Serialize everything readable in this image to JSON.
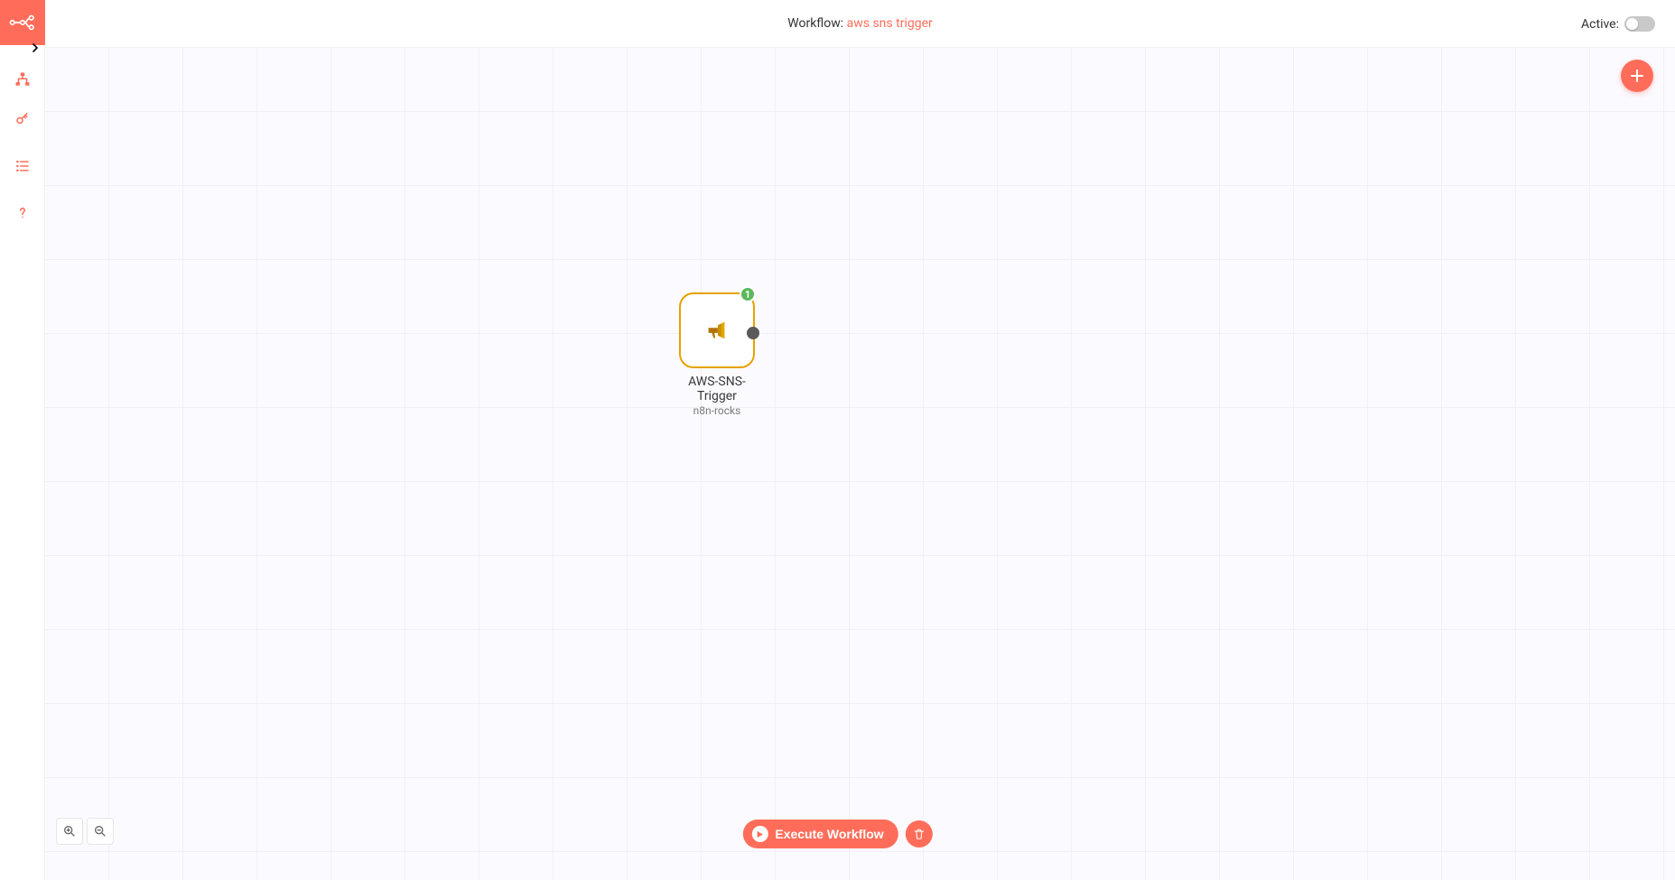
{
  "header": {
    "workflow_label": "Workflow: ",
    "workflow_name": "aws sns trigger",
    "active_label": "Active: "
  },
  "sidebar": {
    "logo_name": "n8n-logo",
    "items": [
      {
        "name": "workflows-icon"
      },
      {
        "name": "credentials-icon"
      },
      {
        "name": "executions-icon"
      },
      {
        "name": "help-icon"
      }
    ]
  },
  "fab": {
    "name": "add-node-button"
  },
  "node": {
    "title": "AWS-SNS-Trigger",
    "subtitle": "n8n-rocks",
    "badge": "1"
  },
  "actions": {
    "execute_label": "Execute Workflow"
  }
}
